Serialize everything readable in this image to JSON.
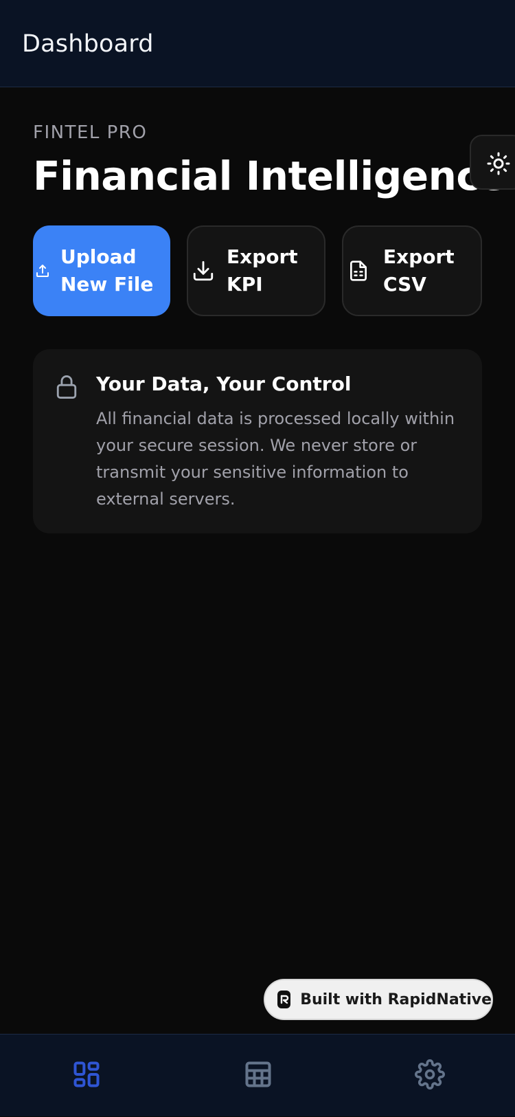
{
  "header": {
    "title": "Dashboard"
  },
  "hero": {
    "kicker": "FINTEL PRO",
    "title": "Financial Intelligence"
  },
  "theme_toggle": {
    "icon": "sun-icon"
  },
  "actions": {
    "upload_label": "Upload\nNew File",
    "export_kpi_label": "Export KPI",
    "export_csv_label": "Export\nCSV"
  },
  "privacy": {
    "icon": "lock-icon",
    "title": "Your Data, Your Control",
    "body": "All financial data is processed locally within your secure session. We never store or transmit your sensitive information to external servers."
  },
  "badge": {
    "text": "Built with RapidNative"
  },
  "tabs": [
    {
      "name": "dashboard",
      "icon": "dashboard-icon",
      "active": true
    },
    {
      "name": "table",
      "icon": "table-icon",
      "active": false
    },
    {
      "name": "settings",
      "icon": "gear-icon",
      "active": false
    }
  ],
  "colors": {
    "accent": "#3b82f6",
    "active_tab": "#2f55d4",
    "inactive_tab": "#64748b",
    "background": "#0a0a0a",
    "bar_background": "#0a1324"
  }
}
